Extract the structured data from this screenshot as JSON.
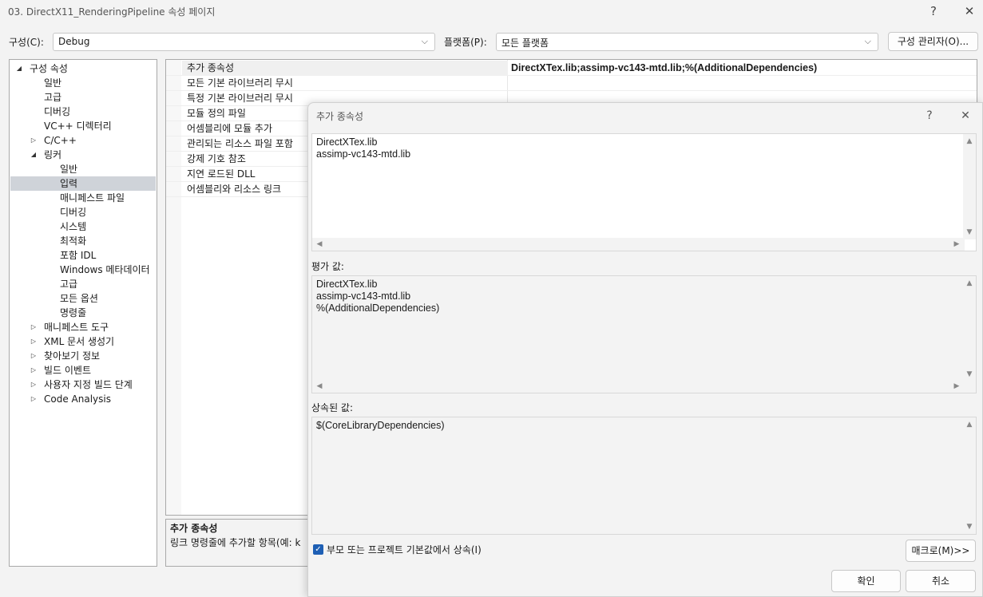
{
  "window": {
    "title": "03. DirectX11_RenderingPipeline 속성 페이지",
    "help_glyph": "?",
    "close_glyph": "✕"
  },
  "config_bar": {
    "config_label": "구성(C):",
    "config_value": "Debug",
    "platform_label": "플랫폼(P):",
    "platform_value": "모든 플랫폼",
    "config_manager_button": "구성 관리자(O)...",
    "chevron_glyph": "⌵"
  },
  "tree": {
    "expanded_glyph": "◢",
    "collapsed_glyph": "▷",
    "items": [
      {
        "label": "구성 속성",
        "level": 0,
        "toggle": "expanded"
      },
      {
        "label": "일반",
        "level": 1,
        "toggle": "none"
      },
      {
        "label": "고급",
        "level": 1,
        "toggle": "none"
      },
      {
        "label": "디버깅",
        "level": 1,
        "toggle": "none"
      },
      {
        "label": "VC++ 디렉터리",
        "level": 1,
        "toggle": "none"
      },
      {
        "label": "C/C++",
        "level": 1,
        "toggle": "collapsed"
      },
      {
        "label": "링커",
        "level": 1,
        "toggle": "expanded"
      },
      {
        "label": "일반",
        "level": 2,
        "toggle": "none"
      },
      {
        "label": "입력",
        "level": 2,
        "toggle": "none",
        "selected": true
      },
      {
        "label": "매니페스트 파일",
        "level": 2,
        "toggle": "none"
      },
      {
        "label": "디버깅",
        "level": 2,
        "toggle": "none"
      },
      {
        "label": "시스템",
        "level": 2,
        "toggle": "none"
      },
      {
        "label": "최적화",
        "level": 2,
        "toggle": "none"
      },
      {
        "label": "포함 IDL",
        "level": 2,
        "toggle": "none"
      },
      {
        "label": "Windows 메타데이터",
        "level": 2,
        "toggle": "none"
      },
      {
        "label": "고급",
        "level": 2,
        "toggle": "none"
      },
      {
        "label": "모든 옵션",
        "level": 2,
        "toggle": "none"
      },
      {
        "label": "명령줄",
        "level": 2,
        "toggle": "none"
      },
      {
        "label": "매니페스트 도구",
        "level": 1,
        "toggle": "collapsed"
      },
      {
        "label": "XML 문서 생성기",
        "level": 1,
        "toggle": "collapsed"
      },
      {
        "label": "찾아보기 정보",
        "level": 1,
        "toggle": "collapsed"
      },
      {
        "label": "빌드 이벤트",
        "level": 1,
        "toggle": "collapsed"
      },
      {
        "label": "사용자 지정 빌드 단계",
        "level": 1,
        "toggle": "collapsed"
      },
      {
        "label": "Code Analysis",
        "level": 1,
        "toggle": "collapsed"
      }
    ]
  },
  "grid": {
    "rows": [
      {
        "name": "추가 종속성",
        "value": "DirectXTex.lib;assimp-vc143-mtd.lib;%(AdditionalDependencies)",
        "selected": true
      },
      {
        "name": "모든 기본 라이브러리 무시",
        "value": ""
      },
      {
        "name": "특정 기본 라이브러리 무시",
        "value": ""
      },
      {
        "name": "모듈 정의 파일",
        "value": ""
      },
      {
        "name": "어셈블리에 모듈 추가",
        "value": ""
      },
      {
        "name": "관리되는 리소스 파일 포함",
        "value": ""
      },
      {
        "name": "강제 기호 참조",
        "value": ""
      },
      {
        "name": "지연 로드된 DLL",
        "value": ""
      },
      {
        "name": "어셈블리와 리소스 링크",
        "value": ""
      }
    ]
  },
  "description": {
    "title": "추가 종속성",
    "text": "링크 명령줄에 추가할 항목(예: k"
  },
  "dialog": {
    "title": "추가 종속성",
    "help_glyph": "?",
    "close_glyph": "✕",
    "edit_lines": [
      "DirectXTex.lib",
      "assimp-vc143-mtd.lib"
    ],
    "evaluated_label": "평가 값:",
    "evaluated_lines": [
      "DirectXTex.lib",
      "assimp-vc143-mtd.lib",
      "%(AdditionalDependencies)"
    ],
    "inherited_label": "상속된 값:",
    "inherited_lines": [
      "$(CoreLibraryDependencies)"
    ],
    "inherit_checkbox_label": "부모 또는 프로젝트 기본값에서 상속(I)",
    "inherit_checked": true,
    "check_glyph": "✓",
    "macro_button": "매크로(M)>>",
    "ok_button": "확인",
    "cancel_button": "취소",
    "scroll_up_glyph": "▲",
    "scroll_down_glyph": "▼",
    "scroll_left_glyph": "◀",
    "scroll_right_glyph": "▶"
  }
}
